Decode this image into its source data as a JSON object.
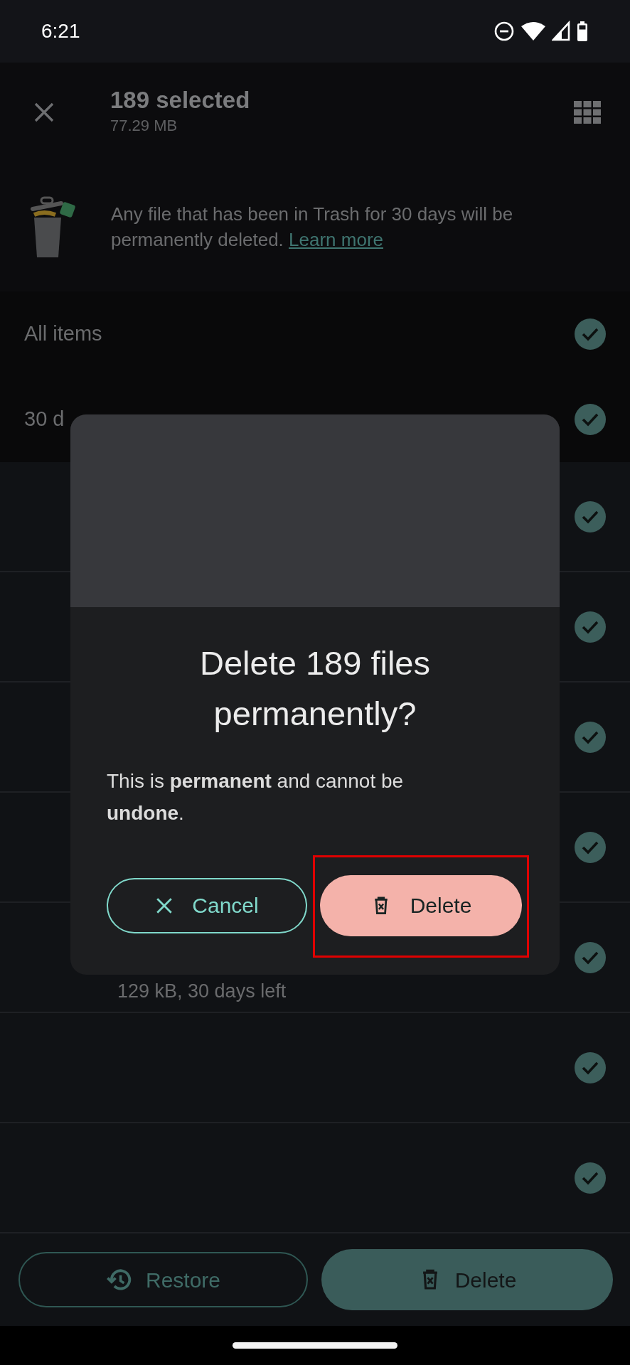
{
  "status_bar": {
    "time": "6:21"
  },
  "app_bar": {
    "title": "189 selected",
    "subtitle": "77.29 MB"
  },
  "banner": {
    "text": "Any file that has been in Trash for 30 days will be permanently deleted.",
    "link": "Learn more"
  },
  "sections": [
    {
      "label": "All items",
      "selected": true
    },
    {
      "label": "30 d",
      "selected": true
    }
  ],
  "files": [
    {
      "selected": true
    },
    {
      "selected": true
    },
    {
      "selected": true
    },
    {
      "selected": true
    },
    {
      "selected": true,
      "detail": "129 kB, 30 days left"
    },
    {
      "selected": true
    },
    {
      "selected": true
    }
  ],
  "dialog": {
    "title": "Delete 189 files permanently?",
    "body": "This is **permanent** and cannot be **undone**.",
    "buttons": [
      {
        "label": "Cancel",
        "kind": "outlined"
      },
      {
        "label": "Delete",
        "kind": "filled",
        "highlighted": true
      }
    ]
  },
  "bottom_bar": {
    "buttons": [
      {
        "label": "Restore",
        "kind": "outlined"
      },
      {
        "label": "Delete",
        "kind": "filled"
      }
    ]
  }
}
